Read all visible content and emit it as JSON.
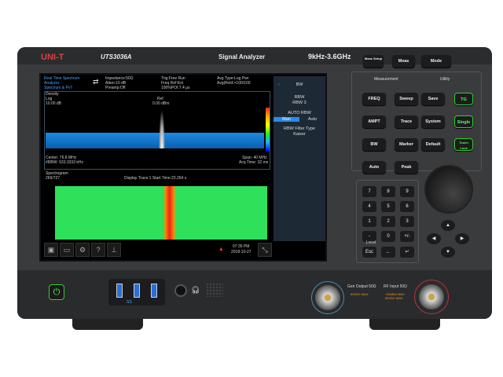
{
  "device": {
    "brand": "UNI-T",
    "model": "UTS3036A",
    "type": "Signal Analyzer",
    "range": "9kHz-3.6GHz"
  },
  "screen": {
    "mode": [
      "Real Time Spectrum",
      "Analyzer",
      "Spectrum & PvT"
    ],
    "info1": [
      "Impedance:50Ω",
      "Atten:10 dB",
      "Preamp:Off"
    ],
    "info2": [
      "Trig:Free Run",
      "Freq Ref:Ext",
      "100%POI:7.4 μs"
    ],
    "info3": [
      "Avg Type:Log Pwr",
      "Avg|Hold:>100/100"
    ],
    "spectrum": {
      "title": "Density",
      "scale": "Log",
      "div": "10.00 dB",
      "ref_label": "Ref",
      "ref": "0.00 dBm",
      "center": "Center: 76.8 MHz",
      "rbw": "#RBW: 533.3333 kHz",
      "span": "Span: 40 MHz",
      "acq": "Acq Time: 32 ms"
    },
    "spectrogram": {
      "title": "Spectrogram",
      "count": "269/727",
      "display": "Display Trace:1  Start Time:23.264 s"
    },
    "menu": {
      "title": "BW",
      "rbw_label": "RBW",
      "rbw_value": "RBW 3",
      "auto_rbw": "AUTO RBW",
      "man": "Man",
      "auto": "Auto",
      "filter_label": "RBW Filter Type",
      "filter_value": "Kaiser"
    },
    "time": "07:35 PM",
    "date": "2018-10-27"
  },
  "keys": {
    "top": [
      "Meas Setup",
      "Meas",
      "Mode"
    ],
    "measurement_label": "Measurement",
    "utility_label": "Utility",
    "measurement": [
      "FREQ",
      "Sweep",
      "AMPT",
      "Trace",
      "BW",
      "Marker",
      "Auto",
      "Peak"
    ],
    "utility": [
      "Save",
      "System",
      "Default"
    ],
    "utility_green": [
      "TG",
      "Single",
      "Touch Lock"
    ],
    "numpad": [
      "7",
      "8",
      "9",
      "4",
      "5",
      "6",
      "1",
      "2",
      "3",
      "-",
      "0",
      "+/-"
    ],
    "local": "Local",
    "bottom": [
      "Esc",
      "←",
      "↵"
    ]
  },
  "front": {
    "gen": "Gen Output 50Ω",
    "gen_warn": "50VDC MAX",
    "rf": "RF Input 50Ω",
    "rf_warn": "+30dBm MAX 50VDC MAX",
    "usb": "SS"
  }
}
